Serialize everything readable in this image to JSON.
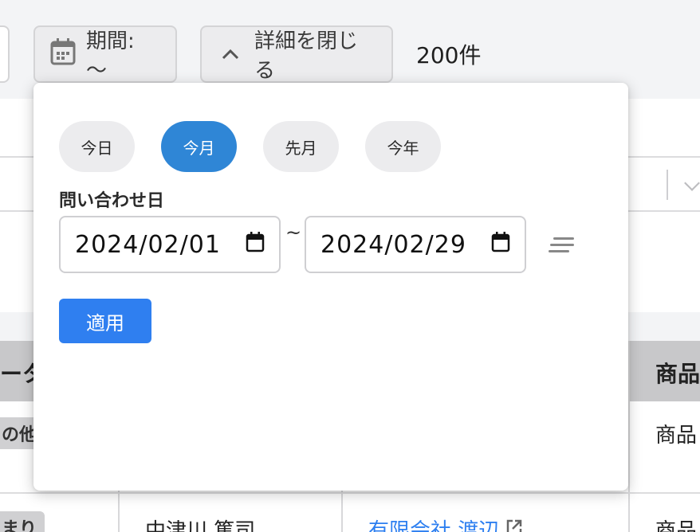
{
  "toolbar": {
    "period_label": "期間: 〜",
    "details_label": "詳細を閉じる",
    "count": "200件"
  },
  "table": {
    "head_left": "ータ",
    "head_right": "商品",
    "row1_badge": "の他",
    "row1_product": "商品",
    "row2_badge": "まり",
    "row2_name": "中津川 篤司",
    "row2_company": "有限会社 渡辺",
    "row2_product": "商品"
  },
  "popover": {
    "presets": [
      "今日",
      "今月",
      "先月",
      "今年"
    ],
    "active_preset": "今月",
    "field_label": "問い合わせ日",
    "date_from": "2024/02/01",
    "date_to": "2024/02/29",
    "separator": "~",
    "apply_label": "適用"
  },
  "colors": {
    "accent": "#2f86d6",
    "apply": "#2f7ff0",
    "link": "#2d7ff0"
  },
  "icons": [
    "calendar-icon",
    "chevron-up-icon",
    "external-link-icon",
    "clear-lines-icon"
  ]
}
